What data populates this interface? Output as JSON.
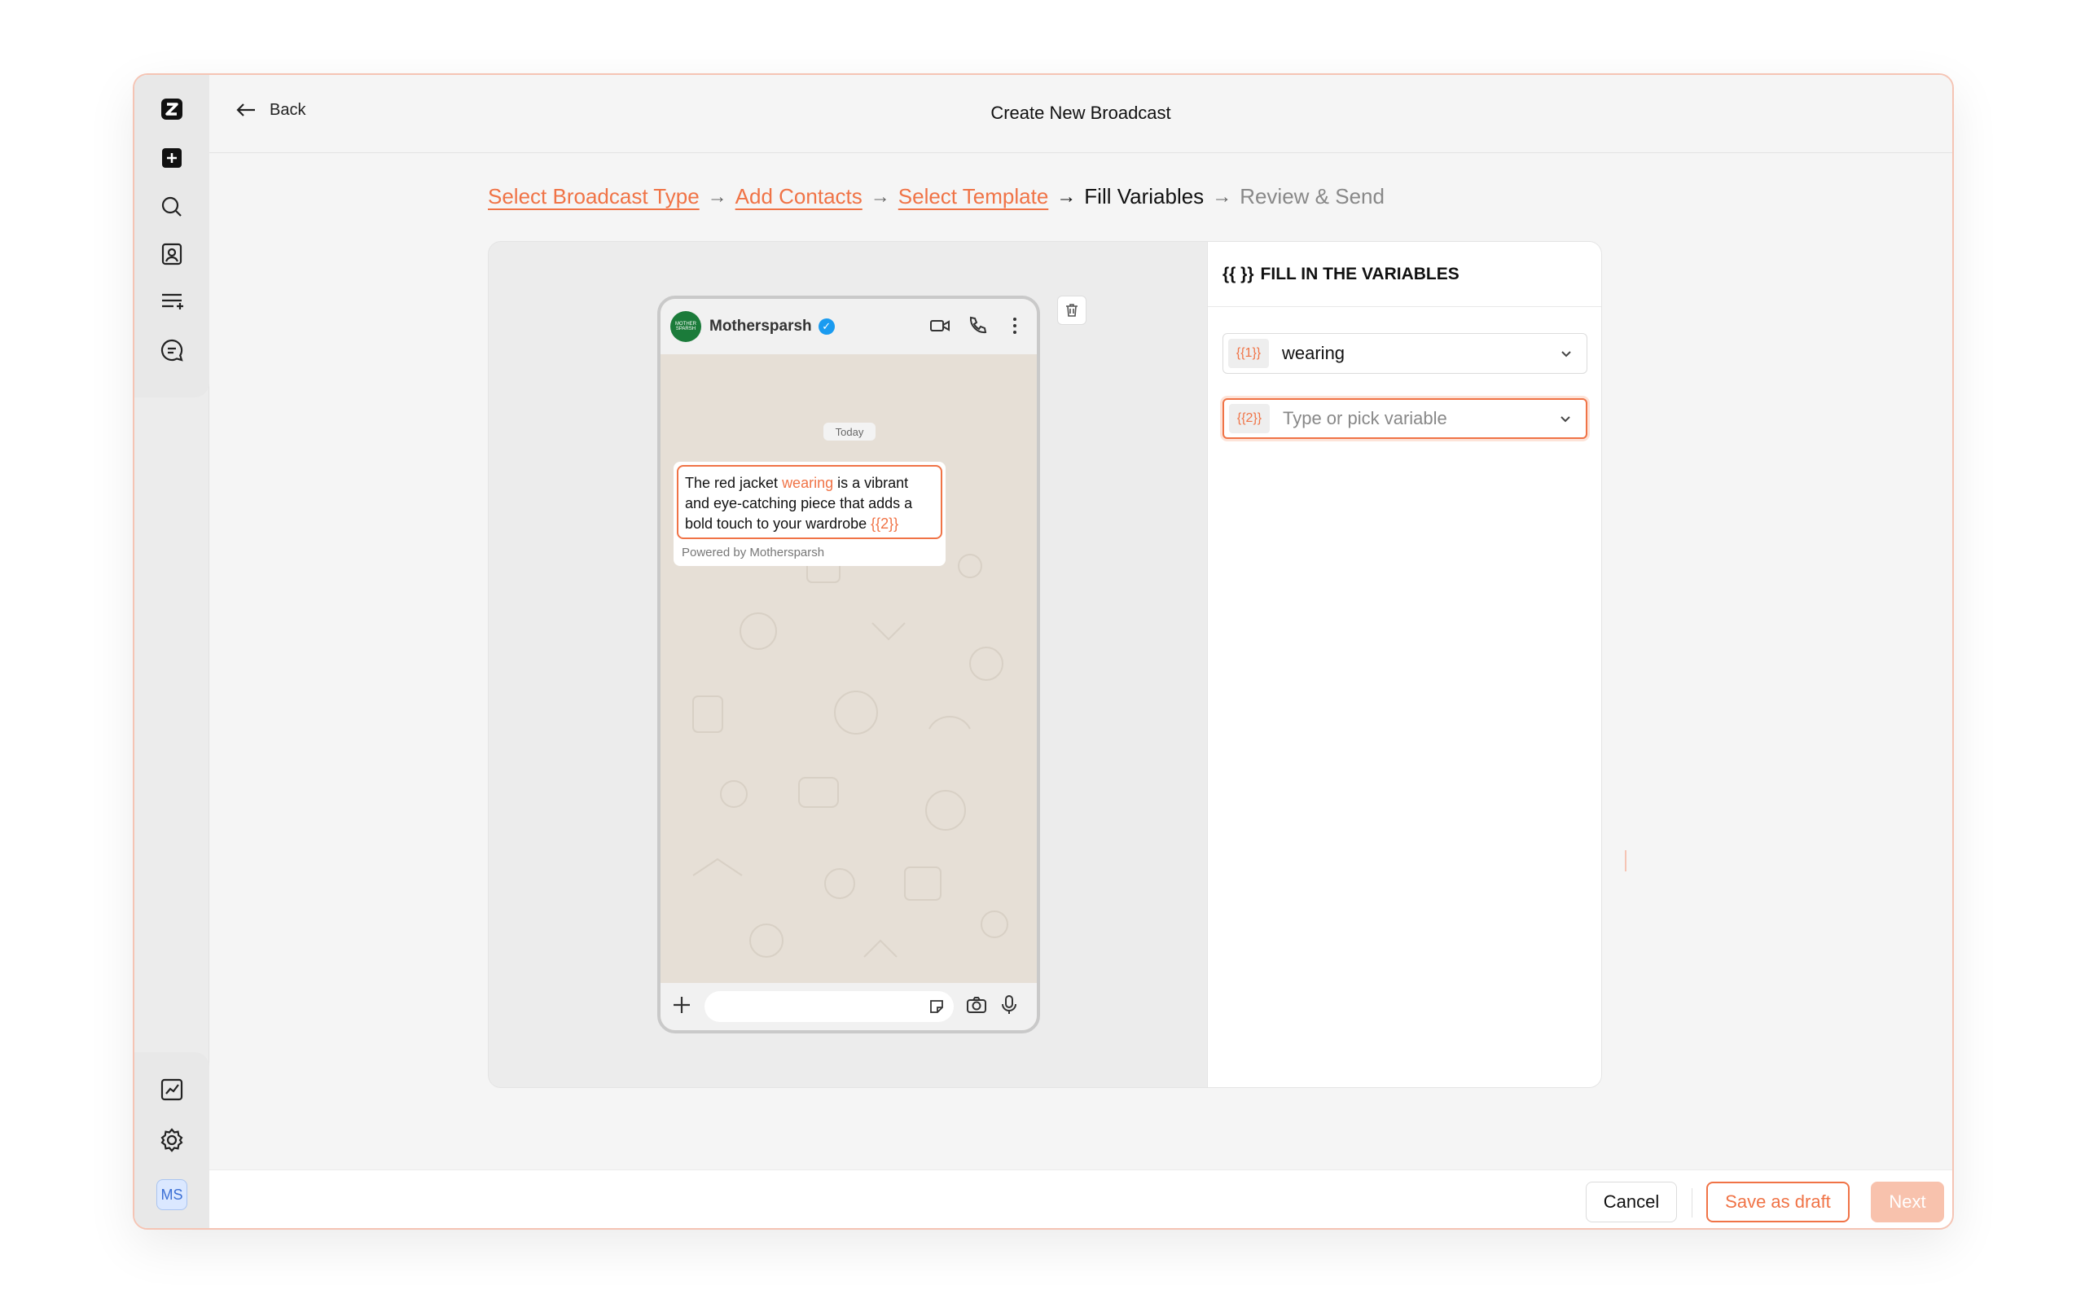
{
  "topbar": {
    "back_label": "Back",
    "title": "Create New Broadcast"
  },
  "stepper": {
    "steps": [
      {
        "label": "Select Broadcast Type",
        "state": "done"
      },
      {
        "label": "Add Contacts",
        "state": "done"
      },
      {
        "label": "Select Template",
        "state": "done"
      },
      {
        "label": "Fill Variables",
        "state": "active"
      },
      {
        "label": "Review & Send",
        "state": "upcoming"
      }
    ],
    "arrow": "→"
  },
  "preview": {
    "contact_name": "Mothersparsh",
    "date_chip": "Today",
    "message_part1": "The red jacket ",
    "message_var1": "wearing",
    "message_part2": " is a vibrant and eye-catching piece that adds a bold touch to your wardrobe ",
    "message_var2": "{{2}}",
    "powered_by": "Powered by Mothersparsh",
    "logo_text": "MOTHER SPARSH"
  },
  "variables": {
    "heading_icon": "{{ }}",
    "heading": "FILL IN THE VARIABLES",
    "fields": [
      {
        "tag": "{{1}}",
        "value": "wearing",
        "placeholder": ""
      },
      {
        "tag": "{{2}}",
        "value": "",
        "placeholder": "Type or pick variable"
      }
    ]
  },
  "footer": {
    "cancel": "Cancel",
    "save_draft": "Save as draft",
    "next": "Next"
  },
  "sidebar": {
    "avatar_initials": "MS"
  },
  "colors": {
    "accent": "#f07346",
    "next_disabled": "#f8c2ad",
    "verified": "#1a9bf0",
    "brand_green": "#1b7b3a"
  }
}
